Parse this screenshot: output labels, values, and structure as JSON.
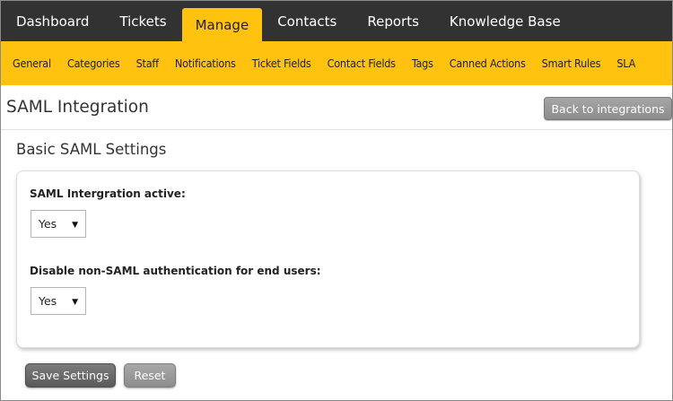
{
  "topnav": {
    "tabs": [
      {
        "label": "Dashboard"
      },
      {
        "label": "Tickets"
      },
      {
        "label": "Manage",
        "active": true
      },
      {
        "label": "Contacts"
      },
      {
        "label": "Reports"
      },
      {
        "label": "Knowledge Base"
      }
    ]
  },
  "subnav": {
    "items": [
      {
        "label": "General"
      },
      {
        "label": "Categories"
      },
      {
        "label": "Staff"
      },
      {
        "label": "Notifications"
      },
      {
        "label": "Ticket Fields"
      },
      {
        "label": "Contact Fields"
      },
      {
        "label": "Tags"
      },
      {
        "label": "Canned Actions"
      },
      {
        "label": "Smart Rules"
      },
      {
        "label": "SLA"
      }
    ]
  },
  "header": {
    "title": "SAML Integration",
    "back_label": "Back to integrations"
  },
  "settings": {
    "section_title": "Basic SAML Settings",
    "fields": [
      {
        "label": "SAML Intergration active:",
        "value": "Yes"
      },
      {
        "label": "Disable non-SAML authentication for end users:",
        "value": "Yes"
      }
    ]
  },
  "actions": {
    "save_label": "Save Settings",
    "reset_label": "Reset"
  },
  "colors": {
    "topnav_bg": "#323232",
    "accent": "#ffc20e"
  }
}
